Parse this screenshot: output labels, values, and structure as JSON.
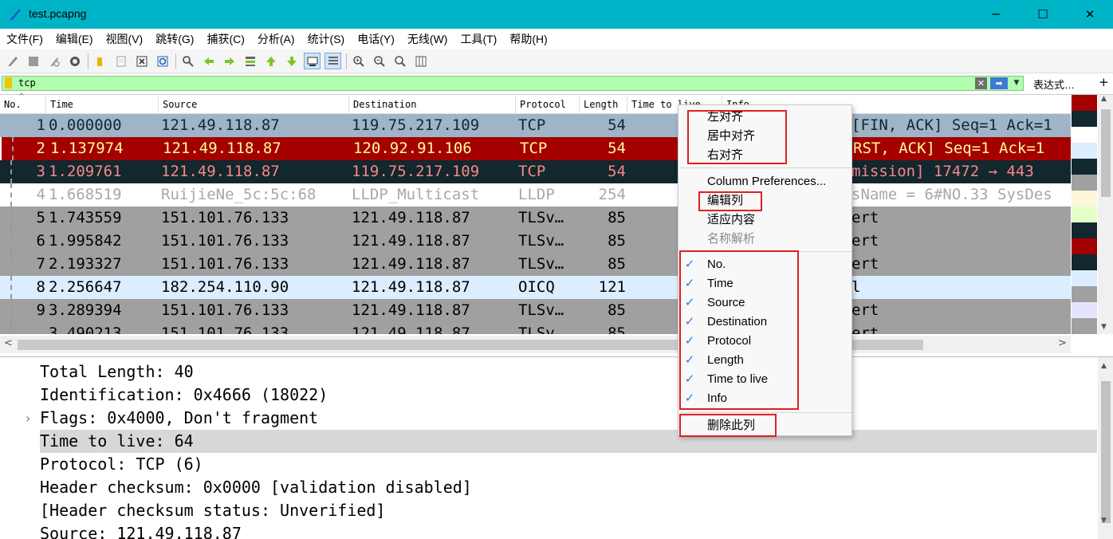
{
  "window": {
    "title": "test.pcapng",
    "minimize_glyph": "─",
    "maximize_glyph": "☐",
    "close_glyph": "✕"
  },
  "menubar": [
    "文件(F)",
    "编辑(E)",
    "视图(V)",
    "跳转(G)",
    "捕获(C)",
    "分析(A)",
    "统计(S)",
    "电话(Y)",
    "无线(W)",
    "工具(T)",
    "帮助(H)"
  ],
  "toolbar": {
    "icons": [
      "shark-fin-start-icon",
      "stop-icon",
      "restart-icon",
      "capture-options-icon",
      "open-folder-icon",
      "file-icon",
      "close-file-icon",
      "reload-icon",
      "find-icon",
      "go-back-icon",
      "go-forward-icon",
      "go-to-packet-icon",
      "go-first-icon",
      "go-last-icon",
      "autoscroll-icon",
      "colorize-icon",
      "zoom-in-icon",
      "zoom-out-icon",
      "zoom-normal-icon",
      "resize-columns-icon"
    ]
  },
  "filter": {
    "value": "tcp",
    "clear_glyph": "✕",
    "apply_glyph": "➡",
    "dropdown_glyph": "▼",
    "expression_label": "表达式…",
    "add_glyph": "+"
  },
  "packet_list": {
    "columns": [
      "No.",
      "Time",
      "Source",
      "Destination",
      "Protocol",
      "Length",
      "Time to live",
      "Info"
    ],
    "rows": [
      {
        "no": "1",
        "time": "0.000000",
        "source": "121.49.118.87",
        "destination": "119.75.217.109",
        "protocol": "TCP",
        "length": "54",
        "info": "[FIN, ACK] Seq=1 Ack=1",
        "bg": "#a0b4c8",
        "fg": "#12272e"
      },
      {
        "no": "2",
        "time": "1.137974",
        "source": "121.49.118.87",
        "destination": "120.92.91.106",
        "protocol": "TCP",
        "length": "54",
        "info": "RST, ACK] Seq=1 Ack=1",
        "bg": "#a40000",
        "fg": "#fffc9c"
      },
      {
        "no": "3",
        "time": "1.209761",
        "source": "121.49.118.87",
        "destination": "119.75.217.109",
        "protocol": "TCP",
        "length": "54",
        "info": "mission] 17472 → 443",
        "bg": "#12272e",
        "fg": "#f78787"
      },
      {
        "no": "4",
        "time": "1.668519",
        "source": "RuijieNe_5c:5c:68",
        "destination": "LLDP_Multicast",
        "protocol": "LLDP",
        "length": "254",
        "info": "sName = 6#NO.33 SysDes",
        "bg": "#ffffff",
        "fg": "#a8a8a8"
      },
      {
        "no": "5",
        "time": "1.743559",
        "source": "151.101.76.133",
        "destination": "121.49.118.87",
        "protocol": "TLSv…",
        "length": "85",
        "info": "ert",
        "bg": "#a0a0a0",
        "fg": "#000000"
      },
      {
        "no": "6",
        "time": "1.995842",
        "source": "151.101.76.133",
        "destination": "121.49.118.87",
        "protocol": "TLSv…",
        "length": "85",
        "info": "ert",
        "bg": "#a0a0a0",
        "fg": "#000000"
      },
      {
        "no": "7",
        "time": "2.193327",
        "source": "151.101.76.133",
        "destination": "121.49.118.87",
        "protocol": "TLSv…",
        "length": "85",
        "info": "ert",
        "bg": "#a0a0a0",
        "fg": "#000000"
      },
      {
        "no": "8",
        "time": "2.256647",
        "source": "182.254.110.90",
        "destination": "121.49.118.87",
        "protocol": "OICQ",
        "length": "121",
        "info": "l",
        "bg": "#daeeff",
        "fg": "#000000"
      },
      {
        "no": "9",
        "time": "3.289394",
        "source": "151.101.76.133",
        "destination": "121.49.118.87",
        "protocol": "TLSv…",
        "length": "85",
        "info": "ert",
        "bg": "#a0a0a0",
        "fg": "#000000"
      },
      {
        "no": "",
        "time": "3.490213",
        "source": "151.101.76.133",
        "destination": "121.49.118.87",
        "protocol": "TLSv…",
        "length": "85",
        "info": "ert",
        "bg": "#a0a0a0",
        "fg": "#000000"
      }
    ],
    "minimap_colors": [
      "#a40000",
      "#12272e",
      "#ffffff",
      "#ddeeff",
      "#12272e",
      "#a0a0a0",
      "#fff5d8",
      "#e4ffc7",
      "#12272e",
      "#a40000",
      "#12272e",
      "#daeeff",
      "#a0a0a0",
      "#e4e4ff",
      "#a0a0a0"
    ],
    "scroll_up": "▲",
    "scroll_down": "▼",
    "scroll_left": "<",
    "scroll_right": ">"
  },
  "details": {
    "lines": [
      "Total Length: 40",
      "Identification: 0x4666 (18022)",
      "Flags: 0x4000, Don't fragment",
      "Time to live: 64",
      "Protocol: TCP (6)",
      "Header checksum: 0x0000 [validation disabled]",
      "[Header checksum status: Unverified]",
      "Source: 121.49.118.87"
    ],
    "chevron": "›",
    "scroll_up": "▲",
    "scroll_down": "▼"
  },
  "context_menu": {
    "align_items": [
      "左对齐",
      "居中对齐",
      "右对齐"
    ],
    "column_preferences": "Column Preferences...",
    "edit_column": "编辑列",
    "resize_to_contents": "适应内容",
    "resolve_names": "名称解析",
    "columns": [
      "No.",
      "Time",
      "Source",
      "Destination",
      "Protocol",
      "Length",
      "Time to live",
      "Info"
    ],
    "check_glyph": "✓",
    "remove_column": "删除此列"
  },
  "colors": {
    "titlebar": "#00b4c7",
    "filter_ok": "#afffaf",
    "highlight_red": "#e02020"
  }
}
